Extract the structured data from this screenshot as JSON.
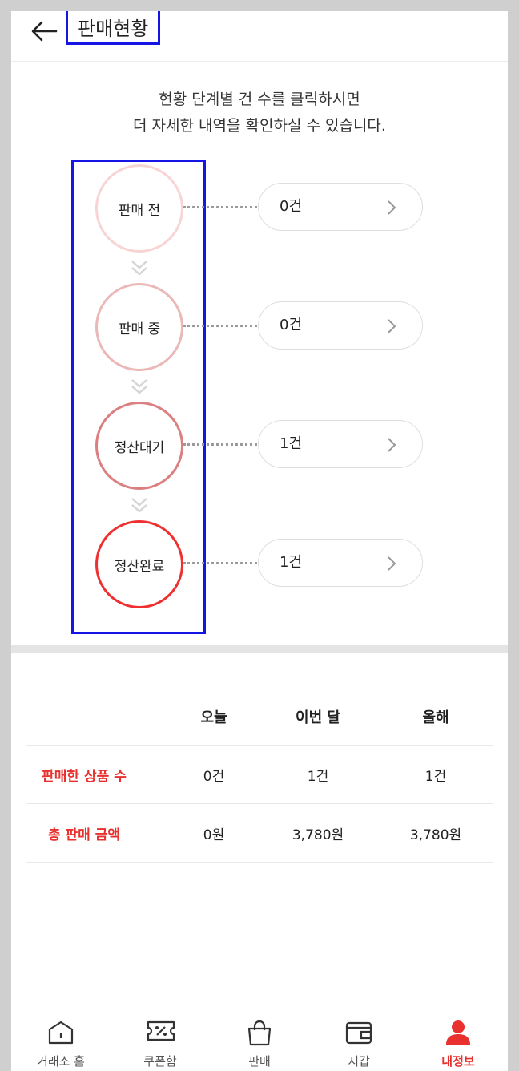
{
  "header": {
    "title": "판매현황"
  },
  "guide": {
    "line1": "현황 단계별 건 수를 클릭하시면",
    "line2": "더 자세한 내역을 확인하실 수 있습니다."
  },
  "steps": [
    {
      "label": "판매 전",
      "count": "0건",
      "color": "#f8d4d4"
    },
    {
      "label": "판매 중",
      "count": "0건",
      "color": "#ebb7b7"
    },
    {
      "label": "정산대기",
      "count": "1건",
      "color": "#dc7f80"
    },
    {
      "label": "정산완료",
      "count": "1건",
      "color": "#ef3030"
    }
  ],
  "summary": {
    "headers": [
      "오늘",
      "이번 달",
      "올해"
    ],
    "rows": [
      {
        "label": "판매한 상품 수",
        "values": [
          "0건",
          "1건",
          "1건"
        ]
      },
      {
        "label": "총 판매 금액",
        "values": [
          "0원",
          "3,780원",
          "3,780원"
        ]
      }
    ]
  },
  "nav": [
    {
      "label": "거래소 홈",
      "icon": "home-icon"
    },
    {
      "label": "쿠폰함",
      "icon": "coupon-icon"
    },
    {
      "label": "판매",
      "icon": "shopping-bag-icon"
    },
    {
      "label": "지갑",
      "icon": "wallet-icon"
    },
    {
      "label": "내정보",
      "icon": "user-icon",
      "active": true
    }
  ],
  "colors": {
    "accent": "#e8312e",
    "highlight_box": "#1515e6"
  }
}
